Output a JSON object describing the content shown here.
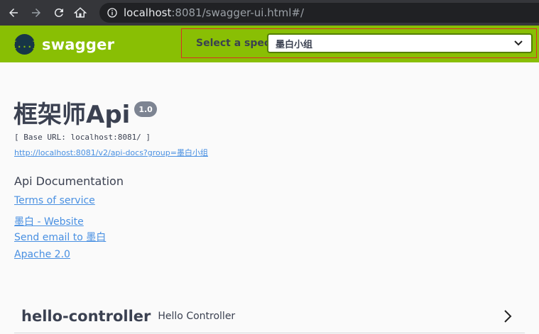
{
  "browser": {
    "url_host": "localhost",
    "url_rest": ":8081/swagger-ui.html#/"
  },
  "topbar": {
    "logo_glyph": "{...}",
    "logo_text": "swagger",
    "spec_label": "Select a spec",
    "spec_selected": "墨白小组",
    "colors": {
      "bar": "#89bf04",
      "logo_bg": "#173647",
      "select_border": "#547f00",
      "highlight_border": "#d93025"
    }
  },
  "info": {
    "title": "框架师Api",
    "version": "1.0",
    "base_url": "[ Base URL: localhost:8081/ ]",
    "spec_url": "http://localhost:8081/v2/api-docs?group=墨白小组",
    "description": "Api Documentation",
    "terms": "Terms of service",
    "website": "墨白 - Website",
    "email": "Send email to 墨白",
    "license": "Apache 2.0"
  },
  "tags": [
    {
      "name": "hello-controller",
      "description": "Hello Controller"
    }
  ]
}
